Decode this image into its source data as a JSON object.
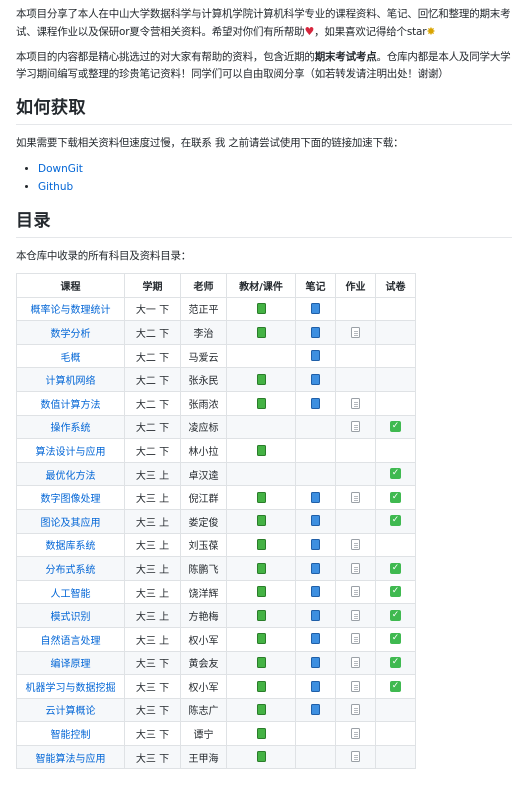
{
  "intro": {
    "p1": "本项目分享了本人在中山大学数据科学与计算机学院计算机科学专业的课程资料、笔记、回忆和整理的期末考试、课程作业以及保研or夏令营相关资料。希望对你们有所帮助",
    "p1_tail": "，如果喜欢记得给个star",
    "p2_a": "本项目的内容都是精心挑选过的对大家有帮助的资料，包含近期的",
    "p2_bold": "期末考试考点",
    "p2_b": "。仓库内都是本人及同学大学学习期间编写或整理的珍贵笔记资料！同学们可以自由取阅分享（如若转发请注明出处！谢谢）"
  },
  "how": {
    "heading": "如何获取",
    "desc": "如果需要下载相关资料但速度过慢，在联系 我 之前请尝试使用下面的链接加速下载：",
    "links": [
      "DownGit",
      "Github"
    ]
  },
  "toc": {
    "heading": "目录",
    "desc": "本仓库中收录的所有科目及资料目录："
  },
  "table": {
    "headers": [
      "课程",
      "学期",
      "老师",
      "教材/课件",
      "笔记",
      "作业",
      "试卷"
    ],
    "rows": [
      {
        "course": "概率论与数理统计",
        "term": "大一 下",
        "teacher": "范正平",
        "textbook": "green",
        "notes": "blue",
        "homework": "",
        "exam": ""
      },
      {
        "course": "数学分析",
        "term": "大二 下",
        "teacher": "李治",
        "textbook": "green",
        "notes": "blue",
        "homework": "memo",
        "exam": ""
      },
      {
        "course": "毛概",
        "term": "大二 下",
        "teacher": "马爱云",
        "textbook": "",
        "notes": "blue",
        "homework": "",
        "exam": ""
      },
      {
        "course": "计算机网络",
        "term": "大二 下",
        "teacher": "张永民",
        "textbook": "green",
        "notes": "blue",
        "homework": "",
        "exam": ""
      },
      {
        "course": "数值计算方法",
        "term": "大二 下",
        "teacher": "张雨浓",
        "textbook": "green",
        "notes": "blue",
        "homework": "memo",
        "exam": ""
      },
      {
        "course": "操作系统",
        "term": "大二 下",
        "teacher": "凌应标",
        "textbook": "",
        "notes": "",
        "homework": "memo",
        "exam": "check"
      },
      {
        "course": "算法设计与应用",
        "term": "大二 下",
        "teacher": "林小拉",
        "textbook": "green",
        "notes": "",
        "homework": "",
        "exam": ""
      },
      {
        "course": "最优化方法",
        "term": "大三 上",
        "teacher": "卓汉逵",
        "textbook": "",
        "notes": "",
        "homework": "",
        "exam": "check"
      },
      {
        "course": "数字图像处理",
        "term": "大三 上",
        "teacher": "倪江群",
        "textbook": "green",
        "notes": "blue",
        "homework": "memo",
        "exam": "check"
      },
      {
        "course": "图论及其应用",
        "term": "大三 上",
        "teacher": "娄定俊",
        "textbook": "green",
        "notes": "blue",
        "homework": "",
        "exam": "check"
      },
      {
        "course": "数据库系统",
        "term": "大三 上",
        "teacher": "刘玉葆",
        "textbook": "green",
        "notes": "blue",
        "homework": "memo",
        "exam": ""
      },
      {
        "course": "分布式系统",
        "term": "大三 上",
        "teacher": "陈鹏飞",
        "textbook": "green",
        "notes": "blue",
        "homework": "memo",
        "exam": "check"
      },
      {
        "course": "人工智能",
        "term": "大三 上",
        "teacher": "饶洋辉",
        "textbook": "green",
        "notes": "blue",
        "homework": "memo",
        "exam": "check"
      },
      {
        "course": "模式识别",
        "term": "大三 上",
        "teacher": "方艳梅",
        "textbook": "green",
        "notes": "blue",
        "homework": "memo",
        "exam": "check"
      },
      {
        "course": "自然语言处理",
        "term": "大三 上",
        "teacher": "权小军",
        "textbook": "green",
        "notes": "blue",
        "homework": "memo",
        "exam": "check"
      },
      {
        "course": "编译原理",
        "term": "大三 下",
        "teacher": "黄会友",
        "textbook": "green",
        "notes": "blue",
        "homework": "memo",
        "exam": "check"
      },
      {
        "course": "机器学习与数据挖掘",
        "term": "大三 下",
        "teacher": "权小军",
        "textbook": "green",
        "notes": "blue",
        "homework": "memo",
        "exam": "check"
      },
      {
        "course": "云计算概论",
        "term": "大三 下",
        "teacher": "陈志广",
        "textbook": "green",
        "notes": "blue",
        "homework": "memo",
        "exam": ""
      },
      {
        "course": "智能控制",
        "term": "大三 下",
        "teacher": "谭宁",
        "textbook": "green",
        "notes": "",
        "homework": "memo",
        "exam": ""
      },
      {
        "course": "智能算法与应用",
        "term": "大三 下",
        "teacher": "王甲海",
        "textbook": "green",
        "notes": "",
        "homework": "memo",
        "exam": ""
      }
    ]
  },
  "icons": {
    "green": "green-book-icon",
    "blue": "blue-book-icon",
    "memo": "memo-icon",
    "check": "check-mark-icon"
  },
  "colors": {
    "link": "#0366d6",
    "text": "#24292e",
    "border": "#dfe2e5",
    "stripe": "#f6f8fa"
  }
}
